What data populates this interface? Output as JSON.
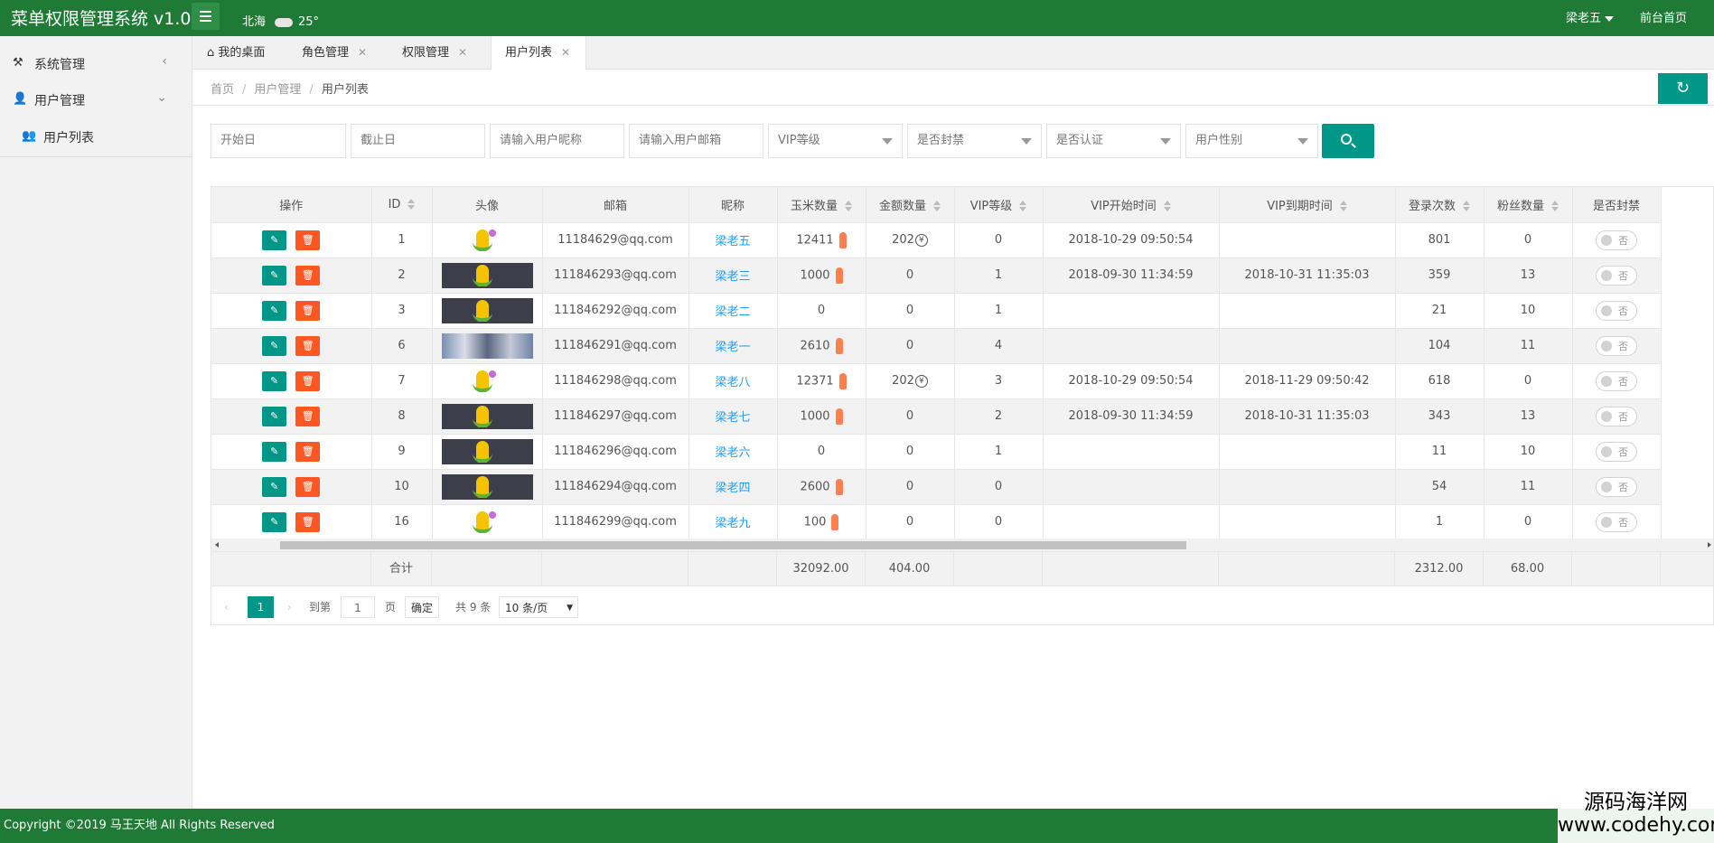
{
  "header": {
    "title": "菜单权限管理系统 v1.0",
    "city": "北海",
    "temp": "25°",
    "user": "梁老五",
    "front": "前台首页"
  },
  "sidebar": {
    "items": [
      {
        "label": "系统管理",
        "arrow": "‹"
      },
      {
        "label": "用户管理",
        "arrow": "⌄"
      },
      {
        "label": "用户列表"
      }
    ]
  },
  "tabs": [
    {
      "label": "我的桌面"
    },
    {
      "label": "角色管理",
      "close": "✕"
    },
    {
      "label": "权限管理",
      "close": "✕"
    },
    {
      "label": "用户列表",
      "close": "✕"
    }
  ],
  "breadcrumb": {
    "home": "首页",
    "sep": "/",
    "section": "用户管理",
    "current": "用户列表"
  },
  "filters": {
    "start": "开始日",
    "end": "截止日",
    "nickname": "请输入用户昵称",
    "email": "请输入用户邮箱",
    "vip": "VIP等级",
    "banned": "是否封禁",
    "verified": "是否认证",
    "gender": "用户性别"
  },
  "table": {
    "headers": [
      "操作",
      "ID",
      "头像",
      "邮箱",
      "昵称",
      "玉米数量",
      "金额数量",
      "VIP等级",
      "VIP开始时间",
      "VIP到期时间",
      "登录次数",
      "粉丝数量",
      "是否封禁"
    ],
    "edit_icon": "✎",
    "delete_icon": "🗑",
    "switch_text": "否",
    "yen": "¥",
    "rows": [
      {
        "id": "1",
        "avatar": "light",
        "email": "11184629@qq.com",
        "nick": "梁老五",
        "corn": "12411",
        "amount": "202",
        "yen": true,
        "vip": "0",
        "vstart": "2018-10-29 09:50:54",
        "vend": "",
        "login": "801",
        "fans": "0"
      },
      {
        "id": "2",
        "avatar": "dark",
        "email": "111846293@qq.com",
        "nick": "梁老三",
        "corn": "1000",
        "amount": "0",
        "yen": false,
        "vip": "1",
        "vstart": "2018-09-30 11:34:59",
        "vend": "2018-10-31 11:35:03",
        "login": "359",
        "fans": "13"
      },
      {
        "id": "3",
        "avatar": "dark",
        "email": "111846292@qq.com",
        "nick": "梁老二",
        "corn": "0",
        "amount": "0",
        "yen": false,
        "vip": "1",
        "vstart": "",
        "vend": "",
        "login": "21",
        "fans": "10"
      },
      {
        "id": "6",
        "avatar": "photo",
        "email": "111846291@qq.com",
        "nick": "梁老一",
        "corn": "2610",
        "amount": "0",
        "yen": false,
        "vip": "4",
        "vstart": "",
        "vend": "",
        "login": "104",
        "fans": "11"
      },
      {
        "id": "7",
        "avatar": "light",
        "email": "111846298@qq.com",
        "nick": "梁老八",
        "corn": "12371",
        "amount": "202",
        "yen": true,
        "vip": "3",
        "vstart": "2018-10-29 09:50:54",
        "vend": "2018-11-29 09:50:42",
        "login": "618",
        "fans": "0"
      },
      {
        "id": "8",
        "avatar": "dark",
        "email": "111846297@qq.com",
        "nick": "梁老七",
        "corn": "1000",
        "amount": "0",
        "yen": false,
        "vip": "2",
        "vstart": "2018-09-30 11:34:59",
        "vend": "2018-10-31 11:35:03",
        "login": "343",
        "fans": "13"
      },
      {
        "id": "9",
        "avatar": "dark",
        "email": "111846296@qq.com",
        "nick": "梁老六",
        "corn": "0",
        "amount": "0",
        "yen": false,
        "vip": "1",
        "vstart": "",
        "vend": "",
        "login": "11",
        "fans": "10"
      },
      {
        "id": "10",
        "avatar": "dark",
        "email": "111846294@qq.com",
        "nick": "梁老四",
        "corn": "2600",
        "amount": "0",
        "yen": false,
        "vip": "0",
        "vstart": "",
        "vend": "",
        "login": "54",
        "fans": "11"
      },
      {
        "id": "16",
        "avatar": "light",
        "email": "111846299@qq.com",
        "nick": "梁老九",
        "corn": "100",
        "amount": "0",
        "yen": false,
        "vip": "0",
        "vstart": "",
        "vend": "",
        "login": "1",
        "fans": "0"
      }
    ],
    "totals": {
      "label": "合计",
      "corn": "32092.00",
      "amount": "404.00",
      "login": "2312.00",
      "fans": "68.00"
    }
  },
  "pager": {
    "current": "1",
    "goto": "到第",
    "page_value": "1",
    "page_unit": "页",
    "confirm": "确定",
    "total": "共 9 条",
    "per_page": "10 条/页"
  },
  "footer": {
    "copyright": "Copyright ©2019 马王天地 All Rights Reserved"
  },
  "watermark": {
    "line1": "源码海洋网",
    "line2": "www.codehy.com"
  },
  "colors": {
    "header": "#1e7a34",
    "accent": "#009688",
    "danger": "#ff5722",
    "link": "#1e9fff"
  }
}
